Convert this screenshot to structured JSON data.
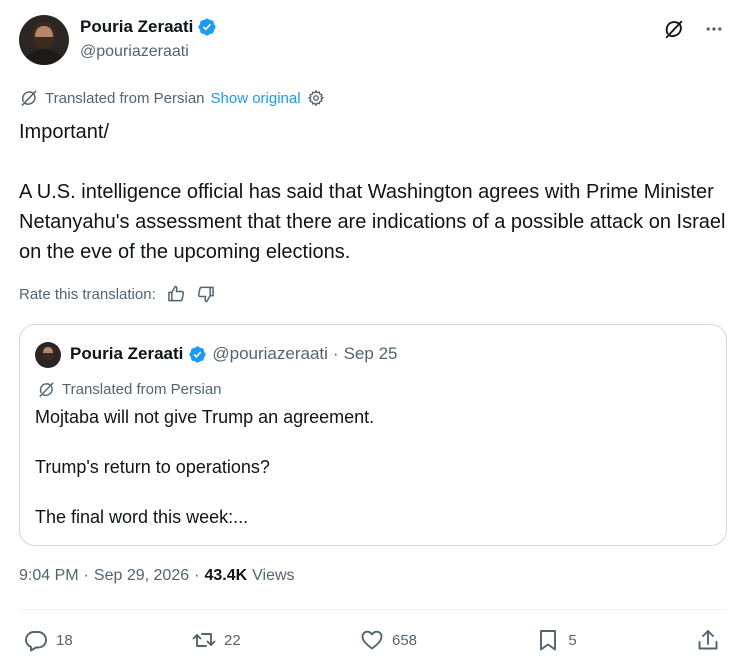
{
  "author": {
    "name": "Pouria Zeraati",
    "handle": "@pouriazeraati",
    "verified_color": "#1d9bf0"
  },
  "translation": {
    "label": "Translated from Persian",
    "show_original": "Show original",
    "rate_label": "Rate this translation:"
  },
  "tweet": {
    "text": "Important/\n\nA U.S. intelligence official has said that Washington agrees with Prime Minister Netanyahu's assessment that there are indications of a possible attack on Israel on the eve of the upcoming elections."
  },
  "quote": {
    "name": "Pouria Zeraati",
    "handle": "@pouriazeraati",
    "separator": "·",
    "date": "Sep 25",
    "translated_label": "Translated from Persian",
    "text": "Mojtaba will not give Trump an agreement.\n\nTrump's return to operations?\n\nThe final word this week:..."
  },
  "meta": {
    "time": "9:04 PM",
    "sep1": "·",
    "date": "Sep 29, 2026",
    "sep2": "·",
    "views_count": "43.4K",
    "views_label": "Views"
  },
  "actions": {
    "replies": "18",
    "reposts": "22",
    "likes": "658",
    "bookmarks": "5"
  },
  "icons": {
    "grok": "grok-icon",
    "more": "more-icon",
    "translate": "translate-icon",
    "settings": "gear-icon",
    "thumbs_up": "thumbs-up-icon",
    "thumbs_down": "thumbs-down-icon",
    "reply": "reply-icon",
    "repost": "repost-icon",
    "like": "heart-icon",
    "bookmark": "bookmark-icon",
    "share": "share-icon"
  }
}
